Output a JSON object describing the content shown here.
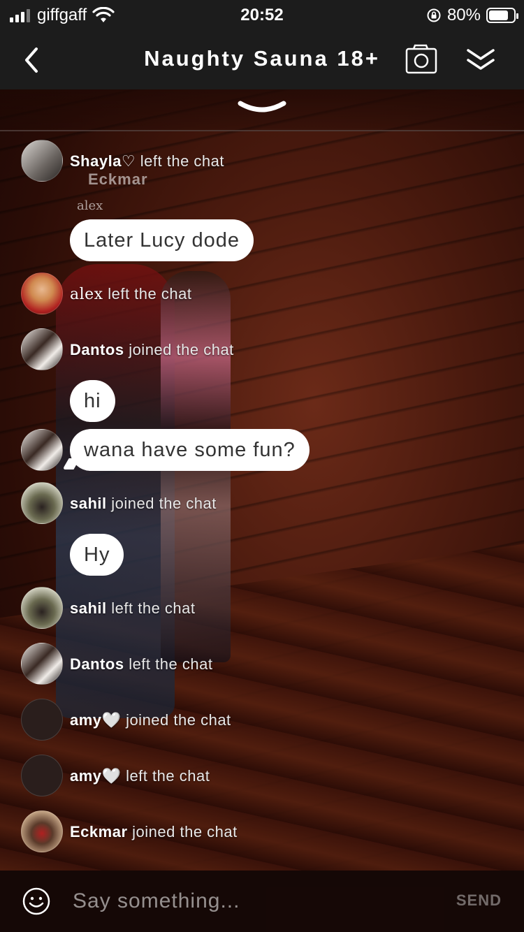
{
  "status_bar": {
    "carrier": "giffgaff",
    "time": "20:52",
    "battery": "80%",
    "battery_level": 0.8
  },
  "header": {
    "title": "Naughty Sauna 18+"
  },
  "overlay": {
    "ghost_name_eckmar": "Eckmar",
    "label_alex": "alex"
  },
  "messages": [
    {
      "type": "system",
      "user": "Shayla♡",
      "text": "left the chat"
    },
    {
      "type": "bubble",
      "text": "Later Lucy dode"
    },
    {
      "type": "system",
      "user": "alex",
      "text": "left the chat"
    },
    {
      "type": "system",
      "user": "Dantos",
      "text": "joined the chat"
    },
    {
      "type": "bubble",
      "text": "hi"
    },
    {
      "type": "bubble",
      "text": "wana have some fun?"
    },
    {
      "type": "system",
      "user": "sahil",
      "text": "joined the chat"
    },
    {
      "type": "bubble",
      "text": "Hy"
    },
    {
      "type": "system",
      "user": "sahil",
      "text": "left the chat"
    },
    {
      "type": "system",
      "user": "Dantos",
      "text": "left the chat"
    },
    {
      "type": "system",
      "user": "amy🤍",
      "text": "joined the chat"
    },
    {
      "type": "system",
      "user": "amy🤍",
      "text": "left the chat"
    },
    {
      "type": "system",
      "user": "Eckmar",
      "text": "joined the chat"
    }
  ],
  "composer": {
    "placeholder": "Say something...",
    "send_label": "SEND"
  },
  "colors": {
    "bar_bg": "#1c1c1c",
    "bubble_bg": "#ffffff",
    "bubble_text": "#333333"
  }
}
